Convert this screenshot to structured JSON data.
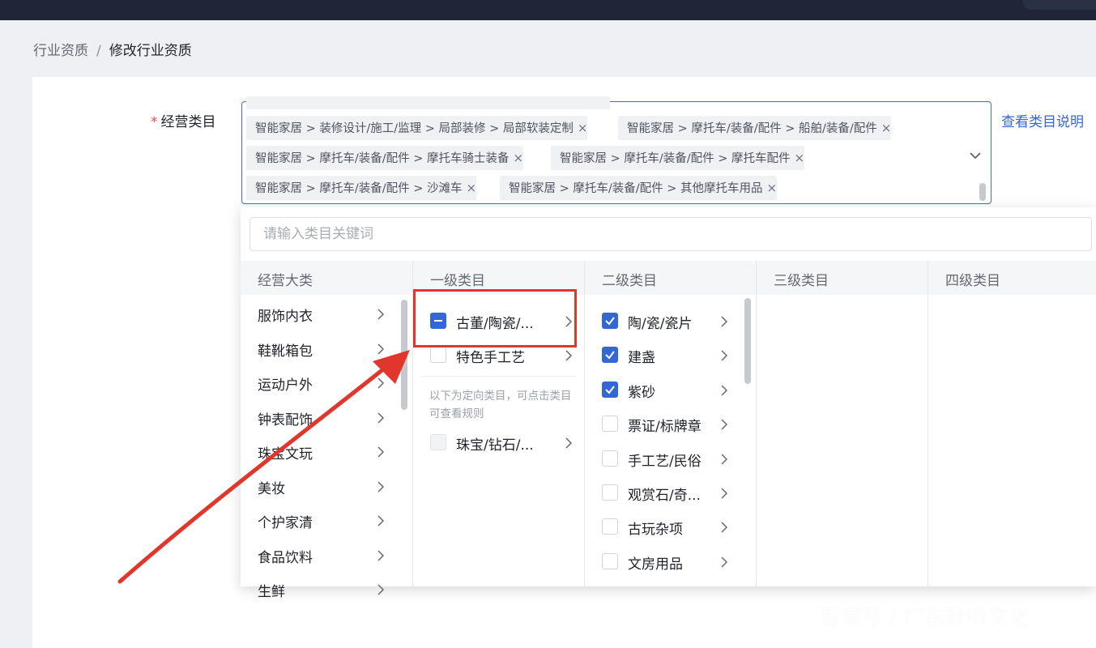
{
  "breadcrumb": {
    "parent": "行业资质",
    "separator": "/",
    "current": "修改行业资质"
  },
  "form": {
    "required_mark": "*",
    "label": "经营类目",
    "view_link": "查看类目说明"
  },
  "selected_tags": [
    "智能家居 > 装修设计/施工/监理 > 局部装修 > 局部软装定制",
    "智能家居 > 摩托车/装备/配件 > 船舶/装备/配件",
    "智能家居 > 摩托车/装备/配件 > 摩托车骑士装备",
    "智能家居 > 摩托车/装备/配件 > 摩托车配件",
    "智能家居 > 摩托车/装备/配件 > 沙滩车",
    "智能家居 > 摩托车/装备/配件 > 其他摩托车用品"
  ],
  "tag_close": "×",
  "search": {
    "placeholder": "请输入类目关键词"
  },
  "columns": {
    "c0": "经营大类",
    "c1": "一级类目",
    "c2": "二级类目",
    "c3": "三级类目",
    "c4": "四级类目"
  },
  "major_categories": [
    "服饰内衣",
    "鞋靴箱包",
    "运动户外",
    "钟表配饰",
    "珠宝文玩",
    "美妆",
    "个护家清",
    "食品饮料",
    "生鲜"
  ],
  "level1": {
    "items": [
      {
        "label": "古董/陶瓷/...",
        "state": "indeterminate"
      },
      {
        "label": "特色手工艺",
        "state": "unchecked"
      }
    ],
    "hint": "以下为定向类目，可点击类目可查看规则",
    "directed": [
      {
        "label": "珠宝/钻石/...",
        "state": "disabled"
      }
    ]
  },
  "level2": {
    "items": [
      {
        "label": "陶/瓷/瓷片",
        "state": "checked"
      },
      {
        "label": "建盏",
        "state": "checked"
      },
      {
        "label": "紫砂",
        "state": "checked"
      },
      {
        "label": "票证/标牌章",
        "state": "unchecked"
      },
      {
        "label": "手工艺/民俗",
        "state": "unchecked"
      },
      {
        "label": "观赏石/奇...",
        "state": "unchecked"
      },
      {
        "label": "古玩杂项",
        "state": "unchecked"
      },
      {
        "label": "文房用品",
        "state": "unchecked"
      }
    ]
  },
  "watermark": "百家号 / 广东聆听文化",
  "colors": {
    "accent": "#3366d6",
    "annotation": "#e0362c",
    "topbar": "#202538"
  },
  "icons": {
    "chevron": "chevron-right-icon",
    "dropdown": "chevron-down-icon"
  }
}
